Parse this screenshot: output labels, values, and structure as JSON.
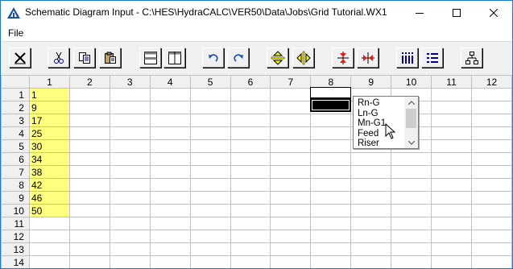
{
  "window": {
    "title": "Schematic Diagram Input - C:\\HES\\HydraCALC\\VER50\\Data\\Jobs\\Grid Tutorial.WX1"
  },
  "menu": {
    "file_label": "File"
  },
  "toolbar": {
    "buttons": [
      {
        "name": "close-x-icon"
      },
      {
        "name": "cut-icon"
      },
      {
        "name": "copy-icon"
      },
      {
        "name": "paste-icon"
      },
      {
        "name": "split-horizontal-icon"
      },
      {
        "name": "split-vertical-icon"
      },
      {
        "name": "undo-icon"
      },
      {
        "name": "redo-icon"
      },
      {
        "name": "expand-vertical-icon"
      },
      {
        "name": "expand-horizontal-icon"
      },
      {
        "name": "collapse-vertical-icon"
      },
      {
        "name": "collapse-horizontal-icon"
      },
      {
        "name": "grid-columns-icon"
      },
      {
        "name": "grid-rows-icon"
      },
      {
        "name": "hierarchy-icon"
      }
    ]
  },
  "grid": {
    "columns": [
      "1",
      "2",
      "3",
      "4",
      "5",
      "6",
      "7",
      "8",
      "9",
      "10",
      "11",
      "12"
    ],
    "rows": [
      "1",
      "2",
      "3",
      "4",
      "5",
      "6",
      "7",
      "8",
      "9",
      "10",
      "11",
      "12",
      "13",
      "14"
    ],
    "col1_values": [
      "1",
      "9",
      "17",
      "25",
      "30",
      "34",
      "38",
      "42",
      "46",
      "50",
      "",
      "",
      "",
      ""
    ],
    "highlight_color": "#ffff80",
    "selected_column": "8"
  },
  "dropdown": {
    "options": [
      "Rn-G",
      "Ln-G",
      "Mn-G1",
      "Feed",
      "Riser"
    ]
  }
}
